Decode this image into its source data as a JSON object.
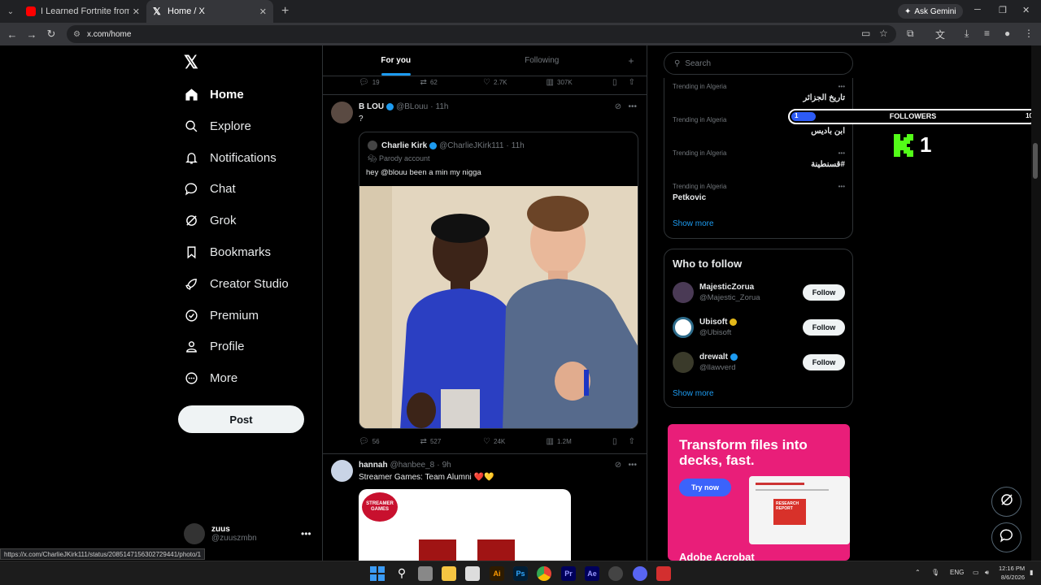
{
  "browser": {
    "tabs": [
      {
        "title": "I Learned Fortnite from a Pro G",
        "icon": "youtube-icon",
        "active": false
      },
      {
        "title": "Home / X",
        "icon": "x-logo-icon",
        "active": true
      }
    ],
    "ask_gemini": "Ask Gemini",
    "url": "x.com/home",
    "status_url": "https://x.com/CharlieJKirk111/status/2085147156302729441/photo/1"
  },
  "sidebar": {
    "items": [
      {
        "label": "Home",
        "icon": "home-icon"
      },
      {
        "label": "Explore",
        "icon": "search-icon"
      },
      {
        "label": "Notifications",
        "icon": "bell-icon"
      },
      {
        "label": "Chat",
        "icon": "chat-icon"
      },
      {
        "label": "Grok",
        "icon": "grok-icon"
      },
      {
        "label": "Bookmarks",
        "icon": "bookmark-icon"
      },
      {
        "label": "Creator Studio",
        "icon": "rocket-icon"
      },
      {
        "label": "Premium",
        "icon": "verified-icon"
      },
      {
        "label": "Profile",
        "icon": "person-icon"
      },
      {
        "label": "More",
        "icon": "more-circle-icon"
      }
    ],
    "post_label": "Post",
    "account": {
      "name": "zuus",
      "handle": "@zuuszmbn"
    }
  },
  "feed": {
    "tabs": [
      "For you",
      "Following"
    ],
    "top_actions": {
      "replies": "19",
      "reposts": "62",
      "likes": "2.7K",
      "views": "307K"
    },
    "post1": {
      "name": "B LOU",
      "handle": "@BLouu",
      "time": "11h",
      "text": "?",
      "quote": {
        "name": "Charlie Kirk",
        "handle": "@CharlieJKirk111",
        "time": "11h",
        "label": "Parody account",
        "text": "hey @blouu been a min my nigga"
      },
      "actions": {
        "replies": "56",
        "reposts": "527",
        "likes": "24K",
        "views": "1.2M"
      }
    },
    "post2": {
      "name": "hannah",
      "handle": "@hanbee_8",
      "time": "9h",
      "text": "Streamer Games: Team Alumni ❤️💛",
      "image_logo": "STREAMER GAMES"
    }
  },
  "right": {
    "search_placeholder": "Search",
    "trends": [
      {
        "context": "Trending in Algeria",
        "title": "تاريخ الجزائر"
      },
      {
        "context": "Trending in Algeria",
        "title": "ابن باديس"
      },
      {
        "context": "Trending in Algeria",
        "title": "#قسنطينة"
      },
      {
        "context": "Trending in Algeria",
        "title": "Petkovic"
      }
    ],
    "show_more": "Show more",
    "who_to_follow": {
      "title": "Who to follow",
      "accounts": [
        {
          "name": "MajesticZorua",
          "handle": "@Majestic_Zorua",
          "verified": false,
          "avatar_color": "#4a3a55"
        },
        {
          "name": "Ubisoft",
          "handle": "@Ubisoft",
          "verified": "gold",
          "avatar_color": "#ffffff"
        },
        {
          "name": "drewalt",
          "handle": "@llawverd",
          "verified": "blue",
          "avatar_color": "#3a3a2a"
        }
      ],
      "follow_label": "Follow",
      "show_more": "Show more"
    },
    "ad": {
      "headline": "Transform files into decks, fast.",
      "cta": "Try now",
      "doc_label": "RESEARCH REPORT",
      "brand": "Adobe Acrobat"
    }
  },
  "overlay": {
    "followers": {
      "label": "FOLLOWERS",
      "current": "1",
      "goal": "10",
      "progress": 0.1
    },
    "kick_count": "1"
  },
  "taskbar": {
    "lang": "ENG",
    "time": "12:16 PM",
    "date": "8/6/2026"
  },
  "colors": {
    "accent": "#1d9bf0",
    "kick_green": "#53fc18",
    "ad_bg": "#e91e79"
  }
}
